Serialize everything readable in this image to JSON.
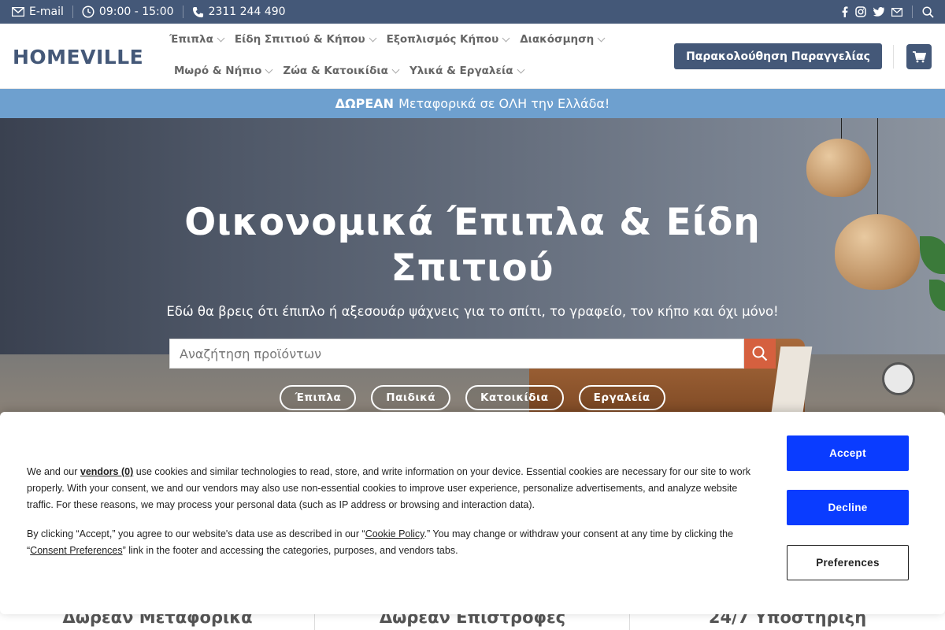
{
  "topbar": {
    "email_label": "E-mail",
    "hours": "09:00 - 15:00",
    "phone": "2311 244 490",
    "social_icons": [
      "facebook-icon",
      "instagram-icon",
      "twitter-icon",
      "envelope-icon"
    ],
    "search_icon": "search-icon"
  },
  "header": {
    "logo": "HOMEVILLE",
    "nav_row1": [
      "Έπιπλα",
      "Είδη Σπιτιού & Κήπου",
      "Εξοπλισμός Κήπου",
      "Διακόσμηση"
    ],
    "nav_row2": [
      "Μωρό & Νήπιο",
      "Ζώα & Κατοικίδια",
      "Υλικά & Εργαλεία"
    ],
    "track_order": "Παρακολούθηση Παραγγελίας",
    "cart_icon": "cart-icon"
  },
  "promo": {
    "bold": "ΔΩΡΕΑΝ",
    "text": "Μεταφορικά σε ΟΛΗ την Ελλάδα!"
  },
  "hero": {
    "title": "Οικονομικά Έπιπλα & Είδη Σπιτιού",
    "subtitle": "Εδώ θα βρεις ότι έπιπλο ή αξεσουάρ ψάχνεις για το σπίτι, το γραφείο, τον κήπο και όχι μόνο!",
    "search_placeholder": "Αναζήτηση προϊόντων",
    "chips": [
      "Έπιπλα",
      "Παιδικά",
      "Κατοικίδια",
      "Εργαλεία"
    ]
  },
  "features": [
    "Δωρεαν Μεταφορικα",
    "Δωρεαν Επιστροφες",
    "24/7 Υποστηριξη"
  ],
  "cookie": {
    "p1_before": "We and our ",
    "vendors_link": "vendors (0)",
    "p1_after": " use cookies and similar technologies to read, store, and write information on your device. Essential cookies are necessary for our site to work properly. With your consent, we and our vendors may also use non-essential cookies to improve user experience, personalize advertisements, and analyze website traffic. For these reasons, we may process your personal data (such as IP address or browsing and interaction data).",
    "p2_before": "By clicking “Accept,” you agree to our website's data use as described in our “",
    "cookie_policy_link": "Cookie Policy",
    "p2_middle": ".” You may change or withdraw your consent at any time by clicking the “",
    "consent_link": "Consent Preferences",
    "p2_after": "” link in the footer and accessing the categories, purposes, and vendors tabs.",
    "accept": "Accept",
    "decline": "Decline",
    "preferences": "Preferences",
    "button_color": "#0a3cff"
  },
  "colors": {
    "brand": "#445878",
    "promo": "#6ea0cf",
    "search_button": "#d5603f"
  }
}
